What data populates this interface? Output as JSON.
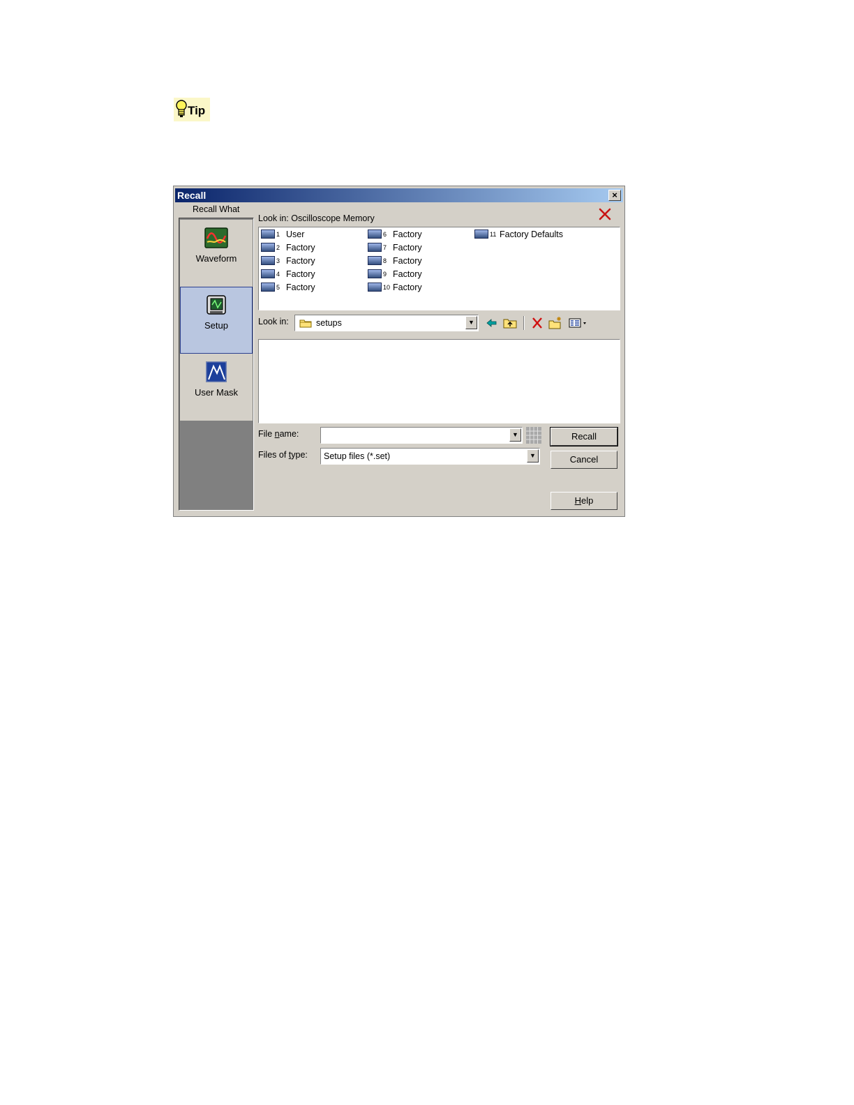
{
  "tip": {
    "label": "Tip"
  },
  "dialog": {
    "title": "Recall",
    "close": "×",
    "recall_what": "Recall What",
    "left_items": [
      {
        "label": "Waveform",
        "icon": "waveform-icon"
      },
      {
        "label": "Setup",
        "icon": "setup-icon",
        "selected": true
      },
      {
        "label": "User Mask",
        "icon": "user-mask-icon"
      }
    ],
    "memory": {
      "look_in": "Look in: Oscilloscope Memory",
      "items": [
        {
          "num": "1",
          "label": "User"
        },
        {
          "num": "2",
          "label": "Factory"
        },
        {
          "num": "3",
          "label": "Factory"
        },
        {
          "num": "4",
          "label": "Factory"
        },
        {
          "num": "5",
          "label": "Factory"
        },
        {
          "num": "6",
          "label": "Factory"
        },
        {
          "num": "7",
          "label": "Factory"
        },
        {
          "num": "8",
          "label": "Factory"
        },
        {
          "num": "9",
          "label": "Factory"
        },
        {
          "num": "10",
          "label": "Factory"
        },
        {
          "num": "11",
          "label": "Factory Defaults"
        }
      ]
    },
    "file": {
      "look_in_label": "Look in:",
      "folder": "setups",
      "file_name_label_pre": "File ",
      "file_name_label_u": "n",
      "file_name_label_post": "ame:",
      "file_name_value": "",
      "files_of_type_label_pre": "Files of ",
      "files_of_type_label_u": "t",
      "files_of_type_label_post": "ype:",
      "files_of_type_value": "Setup files (*.set)"
    },
    "buttons": {
      "recall": "Recall",
      "cancel": "Cancel",
      "help_u": "H",
      "help_rest": "elp"
    }
  }
}
